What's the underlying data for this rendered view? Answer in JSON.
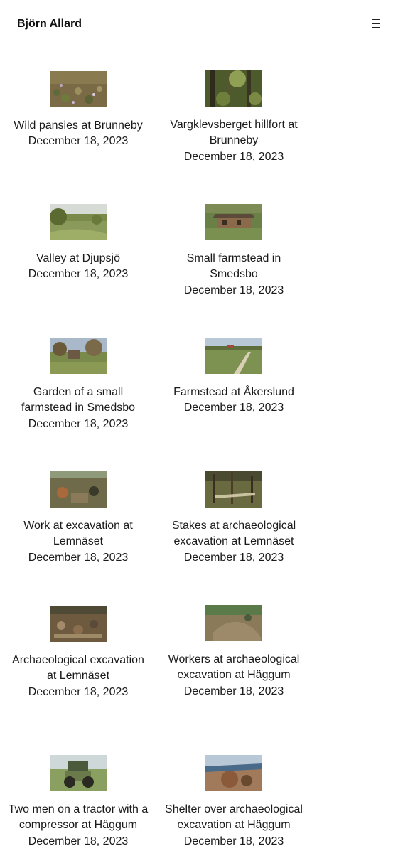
{
  "header": {
    "site_title": "Björn Allard",
    "menu_icon": "hamburger-menu-icon"
  },
  "gallery": {
    "items": [
      {
        "title": "Wild pansies at Brunneby",
        "date": "December 18, 2023",
        "thumb_icon": "photo-wild-pansies"
      },
      {
        "title": "Vargklevsberget hillfort at Brunneby",
        "date": "December 18, 2023",
        "thumb_icon": "photo-forest-hillfort"
      },
      {
        "title": "Valley at Djupsjö",
        "date": "December 18, 2023",
        "thumb_icon": "photo-valley"
      },
      {
        "title": "Small farmstead in Smedsbo",
        "date": "December 18, 2023",
        "thumb_icon": "photo-farmstead-cabin"
      },
      {
        "title": "Garden of a small farmstead in Smedsbo",
        "date": "December 18, 2023",
        "thumb_icon": "photo-garden"
      },
      {
        "title": "Farmstead at Åkerslund",
        "date": "December 18, 2023",
        "thumb_icon": "photo-road-farmstead"
      },
      {
        "title": "Work at excavation at Lemnäset",
        "date": "December 18, 2023",
        "thumb_icon": "photo-excavation-work"
      },
      {
        "title": "Stakes at archaeological excavation at Lemnäset",
        "date": "December 18, 2023",
        "thumb_icon": "photo-excavation-stakes"
      },
      {
        "title": "Archaeological excavation at Lemnäset",
        "date": "December 18, 2023",
        "thumb_icon": "photo-excavation-site"
      },
      {
        "title": "Workers at archaeological excavation at Häggum",
        "date": "December 18, 2023",
        "thumb_icon": "photo-excavation-workers"
      },
      {
        "title": "Two men on a tractor with a compressor at Häggum",
        "date": "December 18, 2023",
        "thumb_icon": "photo-tractor"
      },
      {
        "title": "Shelter over archaeological excavation at Häggum",
        "date": "December 18, 2023",
        "thumb_icon": "photo-shelter"
      }
    ]
  }
}
